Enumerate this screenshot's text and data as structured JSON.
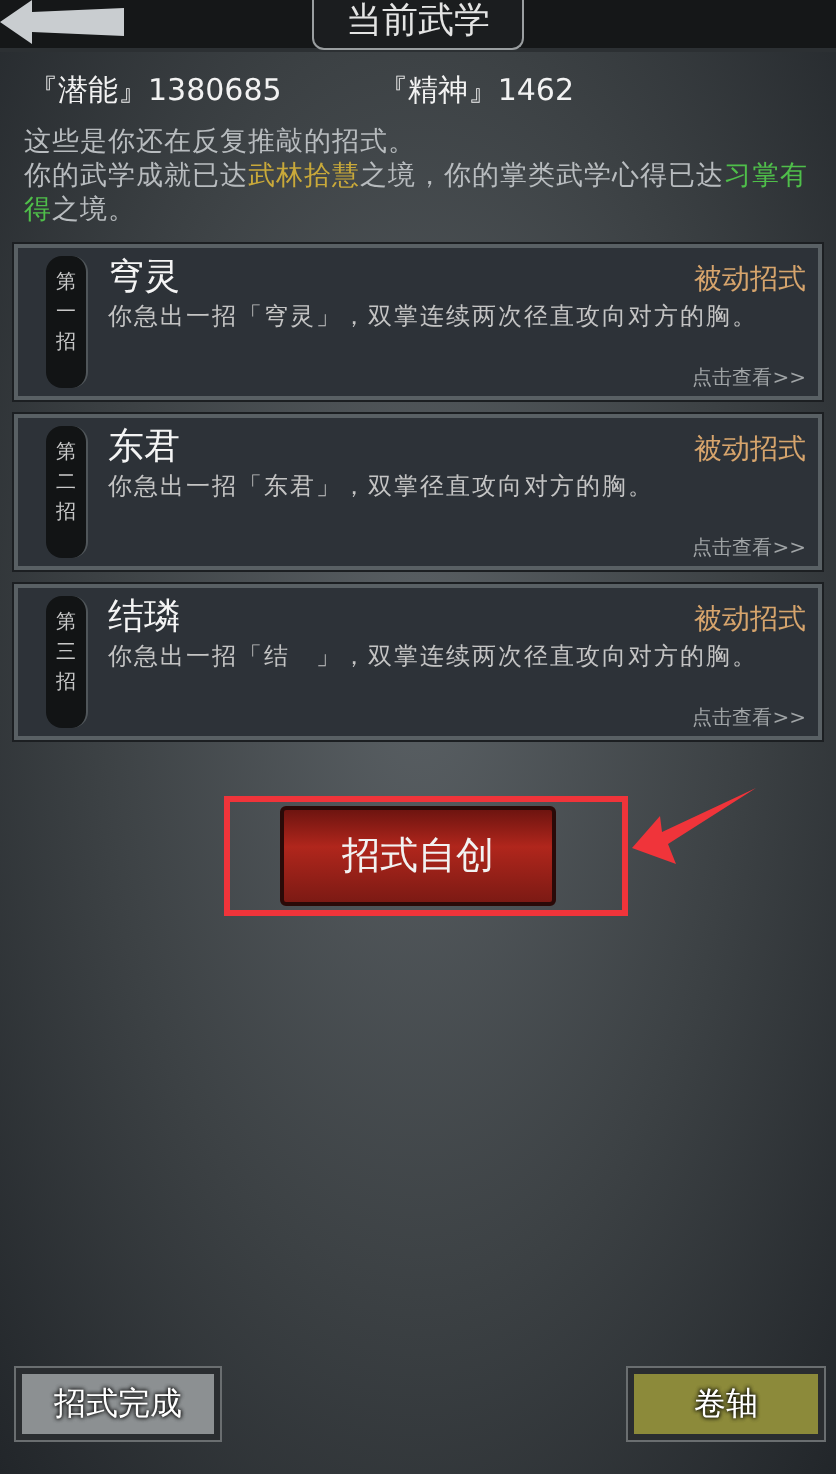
{
  "header": {
    "title": "当前武学"
  },
  "stats": [
    {
      "label": "『潜能』",
      "value": "1380685"
    },
    {
      "label": "『精神』",
      "value": "1462"
    }
  ],
  "intro": [
    {
      "text": "这些是你还在反复推敲的招式。",
      "kind": "plain"
    },
    {
      "text": "你的武学成就已达",
      "kind": "plain"
    },
    {
      "text": "武林拾慧",
      "kind": "gold"
    },
    {
      "text": "之境，你的掌类武学心得已达",
      "kind": "plain"
    },
    {
      "text": "习掌有得",
      "kind": "green"
    },
    {
      "text": "之境。",
      "kind": "plain"
    }
  ],
  "moves": [
    {
      "rank": "第一招",
      "name": "穹灵",
      "type": "被动招式",
      "desc": "你急出一招「穹灵」，双掌连续两次径直攻向对方的胸。",
      "link": "点击查看>>"
    },
    {
      "rank": "第二招",
      "name": "东君",
      "type": "被动招式",
      "desc": "你急出一招「东君」，双掌径直攻向对方的胸。",
      "link": "点击查看>>"
    },
    {
      "rank": "第三招",
      "name": "结璘",
      "type": "被动招式",
      "desc": "你急出一招「结　」，双掌连续两次径直攻向对方的胸。",
      "link": "点击查看>>"
    }
  ],
  "create_button": "招式自创",
  "bottom_buttons": [
    {
      "label": "招式完成",
      "kind": "grey"
    },
    {
      "label": "卷轴",
      "kind": "olive"
    }
  ]
}
